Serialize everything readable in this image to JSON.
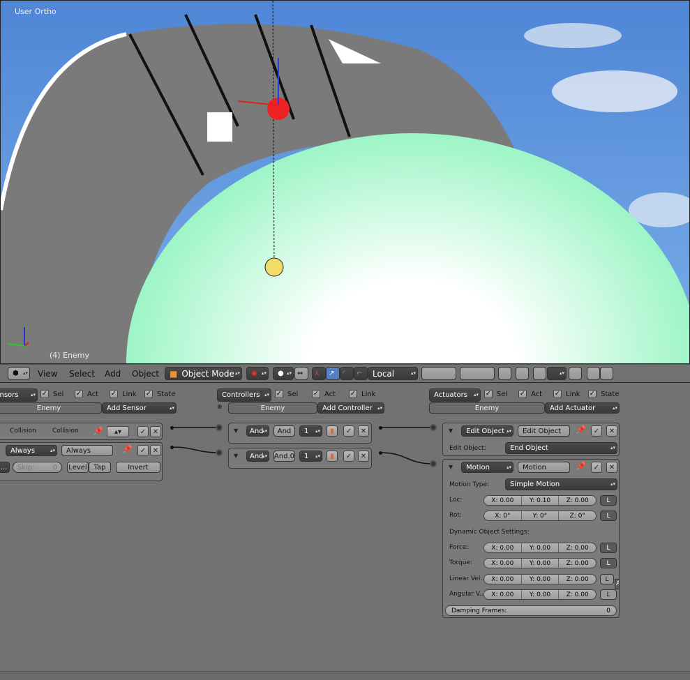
{
  "viewport": {
    "view_label": "User Ortho",
    "object_label": "(4) Enemy",
    "axis_x": "x",
    "axis_y": "y",
    "axis_z": "z"
  },
  "header": {
    "menus": [
      "View",
      "Select",
      "Add",
      "Object"
    ],
    "mode": "Object Mode",
    "orientation": "Local"
  },
  "sensors": {
    "filter": "Sensors",
    "sel": "Sel",
    "act": "Act",
    "link": "Link",
    "state": "State",
    "object": "Enemy",
    "add": "Add Sensor",
    "items": [
      {
        "type": "Collision",
        "name": "Collision"
      },
      {
        "type": "Always",
        "name": "Always",
        "skip_label": "Skip:",
        "skip": "0",
        "level": "Level",
        "tap": "Tap",
        "invert": "Invert",
        "more": "..."
      }
    ]
  },
  "controllers": {
    "filter": "Controllers",
    "sel": "Sel",
    "act": "Act",
    "link": "Link",
    "object": "Enemy",
    "add": "Add Controller",
    "items": [
      {
        "type": "And",
        "name": "And",
        "state": "1"
      },
      {
        "type": "And",
        "name": "And.0",
        "state": "1"
      }
    ]
  },
  "actuators": {
    "filter": "Actuators",
    "sel": "Sel",
    "act": "Act",
    "link": "Link",
    "state": "State",
    "object": "Enemy",
    "add": "Add Actuator",
    "edit_object": {
      "type": "Edit Object",
      "name": "Edit Object",
      "field_label": "Edit Object:",
      "field_value": "End Object"
    },
    "motion": {
      "type": "Motion",
      "name": "Motion",
      "motion_type_label": "Motion Type:",
      "motion_type": "Simple Motion",
      "dynamic_label": "Dynamic Object Settings:",
      "damping_label": "Damping Frames:",
      "damping": "0",
      "add_label": "Ad",
      "rows": [
        {
          "label": "Loc:",
          "x": "X: 0.00",
          "y": "Y: 0.10",
          "z": "Z: 0.00",
          "l": "L"
        },
        {
          "label": "Rot:",
          "x": "X:   0°",
          "y": "Y:   0°",
          "z": "Z:   0°",
          "l": "L"
        },
        {
          "label": "Force:",
          "x": "X: 0.00",
          "y": "Y: 0.00",
          "z": "Z: 0.00",
          "l": "L"
        },
        {
          "label": "Torque:",
          "x": "X: 0.00",
          "y": "Y: 0.00",
          "z": "Z: 0.00",
          "l": "L"
        },
        {
          "label": "Linear Vel...",
          "x": "X: 0.00",
          "y": "Y: 0.00",
          "z": "Z: 0.00",
          "l": "L"
        },
        {
          "label": "Angular V...",
          "x": "X: 0.00",
          "y": "Y: 0.00",
          "z": "Z: 0.00",
          "l": "L"
        }
      ]
    }
  }
}
